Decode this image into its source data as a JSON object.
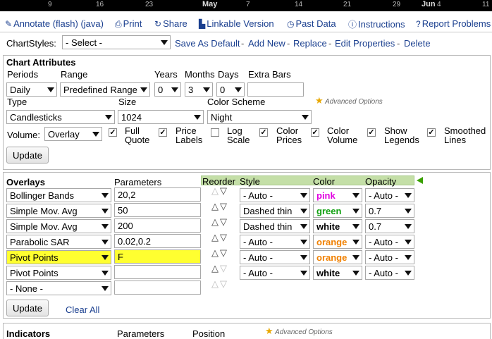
{
  "axis": {
    "ticks": [
      "9",
      "16",
      "23",
      "7",
      "14",
      "21",
      "29",
      "4",
      "11"
    ],
    "major": [
      "May",
      "Jun"
    ]
  },
  "links": {
    "annotate": "Annotate (flash) (java)",
    "print": "Print",
    "share": "Share",
    "linkable": "Linkable Version",
    "past": "Past Data",
    "instructions": "Instructions",
    "report": "Report Problems"
  },
  "chartstyles": {
    "label": "ChartStyles:",
    "select": "- Select -",
    "save_default": "Save As Default",
    "add_new": "Add New",
    "replace": "Replace",
    "edit": "Edit Properties",
    "delete": "Delete",
    "sep": "-"
  },
  "attributes": {
    "title": "Chart Attributes",
    "periods_label": "Periods",
    "periods": "Daily",
    "range_label": "Range",
    "range": "Predefined Range",
    "years_label": "Years",
    "years": "0",
    "months_label": "Months",
    "months": "3",
    "days_label": "Days",
    "days": "0",
    "extra_label": "Extra Bars",
    "extra": "",
    "type_label": "Type",
    "type": "Candlesticks",
    "size_label": "Size",
    "size": "1024",
    "scheme_label": "Color Scheme",
    "scheme": "Night",
    "advanced": "Advanced Options",
    "volume_label": "Volume:",
    "volume": "Overlay",
    "check_mark": "✓",
    "checks": [
      {
        "line1": "Full",
        "line2": "Quote",
        "checked": true
      },
      {
        "line1": "Price",
        "line2": "Labels",
        "checked": true
      },
      {
        "line1": "Log",
        "line2": "Scale",
        "checked": false
      },
      {
        "line1": "Color",
        "line2": "Prices",
        "checked": true
      },
      {
        "line1": "Color",
        "line2": "Volume",
        "checked": true
      },
      {
        "line1": "Show",
        "line2": "Legends",
        "checked": true
      },
      {
        "line1": "Smoothed",
        "line2": "Lines",
        "checked": true
      }
    ],
    "update": "Update"
  },
  "overlays": {
    "title": "Overlays",
    "params_label": "Parameters",
    "reorder_label": "Reorder",
    "style_label": "Style",
    "color_label": "Color",
    "opacity_label": "Opacity",
    "rows": [
      {
        "name": "Bollinger Bands",
        "params": "20,2",
        "style": "- Auto -",
        "color": "pink",
        "opacity": "- Auto -"
      },
      {
        "name": "Simple Mov. Avg",
        "params": "50",
        "style": "Dashed thin",
        "color": "green",
        "opacity": "0.7"
      },
      {
        "name": "Simple Mov. Avg",
        "params": "200",
        "style": "Dashed thin",
        "color": "white",
        "opacity": "0.7"
      },
      {
        "name": "Parabolic SAR",
        "params": "0.02,0.2",
        "style": "- Auto -",
        "color": "orange",
        "opacity": "- Auto -"
      },
      {
        "name": "Pivot Points",
        "params": "F",
        "style": "- Auto -",
        "color": "orange",
        "opacity": "- Auto -"
      },
      {
        "name": "Pivot Points",
        "params": "",
        "style": "- Auto -",
        "color": "white",
        "opacity": "- Auto -"
      },
      {
        "name": "- None -",
        "params": ""
      }
    ],
    "update": "Update",
    "clear": "Clear All"
  },
  "indicators": {
    "title": "Indicators",
    "params_label": "Parameters",
    "position_label": "Position",
    "advanced": "Advanced Options"
  },
  "arrow_up": "△",
  "arrow_down": "▽",
  "star_glyph": "★",
  "colors": {
    "link": "#1a3f8f",
    "highlight": "#ffff30",
    "pink": "#e000e0",
    "green": "#10a010",
    "orange": "#f08000"
  }
}
